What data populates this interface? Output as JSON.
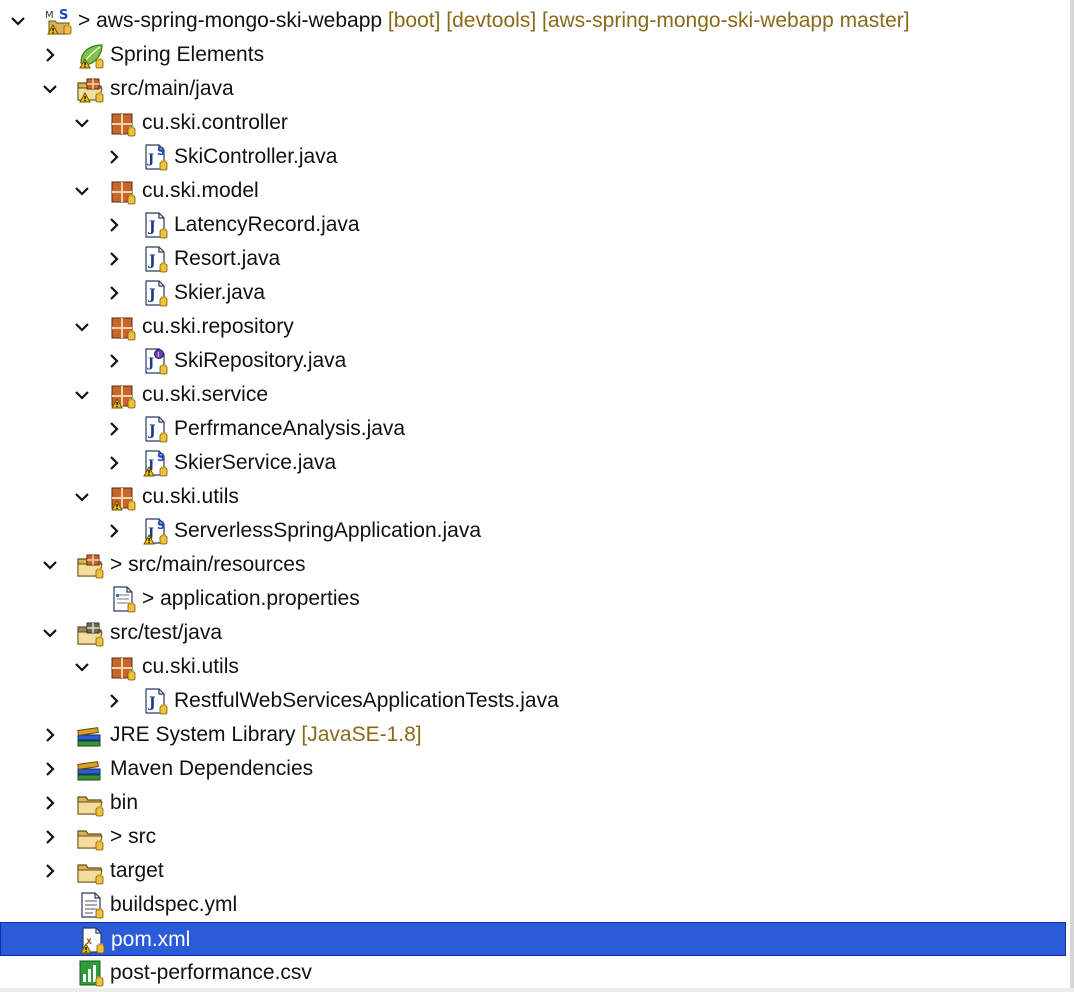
{
  "rows": [
    {
      "label": "> aws-spring-mongo-ski-webapp",
      "decoration": " [boot] [devtools] [aws-spring-mongo-ski-webapp master]",
      "level": 0,
      "expander": "expanded",
      "icon": "project-icon"
    },
    {
      "label": "Spring Elements",
      "level": 1,
      "expander": "collapsed",
      "icon": "spring-leaf-icon"
    },
    {
      "label": "src/main/java",
      "level": 1,
      "expander": "expanded",
      "icon": "source-folder-warning-icon"
    },
    {
      "label": "cu.ski.controller",
      "level": 2,
      "expander": "expanded",
      "icon": "package-icon"
    },
    {
      "label": "SkiController.java",
      "level": 3,
      "expander": "collapsed",
      "icon": "java-spring-file-icon"
    },
    {
      "label": "cu.ski.model",
      "level": 2,
      "expander": "expanded",
      "icon": "package-icon"
    },
    {
      "label": "LatencyRecord.java",
      "level": 3,
      "expander": "collapsed",
      "icon": "java-file-icon"
    },
    {
      "label": "Resort.java",
      "level": 3,
      "expander": "collapsed",
      "icon": "java-file-icon"
    },
    {
      "label": "Skier.java",
      "level": 3,
      "expander": "collapsed",
      "icon": "java-file-icon"
    },
    {
      "label": "cu.ski.repository",
      "level": 2,
      "expander": "expanded",
      "icon": "package-icon"
    },
    {
      "label": "SkiRepository.java",
      "level": 3,
      "expander": "collapsed",
      "icon": "java-interface-file-icon"
    },
    {
      "label": "cu.ski.service",
      "level": 2,
      "expander": "expanded",
      "icon": "package-warning-icon"
    },
    {
      "label": "PerfrmanceAnalysis.java",
      "level": 3,
      "expander": "collapsed",
      "icon": "java-file-icon"
    },
    {
      "label": "SkierService.java",
      "level": 3,
      "expander": "collapsed",
      "icon": "java-spring-file-warning-icon"
    },
    {
      "label": "cu.ski.utils",
      "level": 2,
      "expander": "expanded",
      "icon": "package-warning-icon"
    },
    {
      "label": "ServerlessSpringApplication.java",
      "level": 3,
      "expander": "collapsed",
      "icon": "java-spring-file-warning-icon"
    },
    {
      "label": "> src/main/resources",
      "level": 1,
      "expander": "expanded",
      "icon": "source-folder-icon"
    },
    {
      "label": "> application.properties",
      "level": 2,
      "expander": "none",
      "icon": "properties-file-icon"
    },
    {
      "label": "src/test/java",
      "level": 1,
      "expander": "expanded",
      "icon": "test-source-folder-icon"
    },
    {
      "label": "cu.ski.utils",
      "level": 2,
      "expander": "expanded",
      "icon": "package-icon"
    },
    {
      "label": "RestfulWebServicesApplicationTests.java",
      "level": 3,
      "expander": "collapsed",
      "icon": "java-file-icon"
    },
    {
      "label": "JRE System Library",
      "decoration": " [JavaSE-1.8]",
      "level": 1,
      "expander": "collapsed",
      "icon": "library-icon"
    },
    {
      "label": "Maven Dependencies",
      "level": 1,
      "expander": "collapsed",
      "icon": "library-icon"
    },
    {
      "label": "bin",
      "level": 1,
      "expander": "collapsed",
      "icon": "folder-icon"
    },
    {
      "label": "> src",
      "level": 1,
      "expander": "collapsed",
      "icon": "folder-icon"
    },
    {
      "label": "target",
      "level": 1,
      "expander": "collapsed",
      "icon": "folder-icon"
    },
    {
      "label": "buildspec.yml",
      "level": 1,
      "expander": "none",
      "icon": "text-file-icon"
    },
    {
      "label": "pom.xml",
      "level": 1,
      "expander": "none",
      "icon": "xml-file-warning-icon",
      "selected": true
    },
    {
      "label": "post-performance.csv",
      "level": 1,
      "expander": "none",
      "icon": "csv-file-icon"
    }
  ],
  "colors": {
    "selection": "#2a5cd9",
    "decoration": "#8a6a1a",
    "package": "#a0522d",
    "java": "#1a3a8a",
    "folder": "#d9b25a",
    "warning": "#e0a800"
  }
}
